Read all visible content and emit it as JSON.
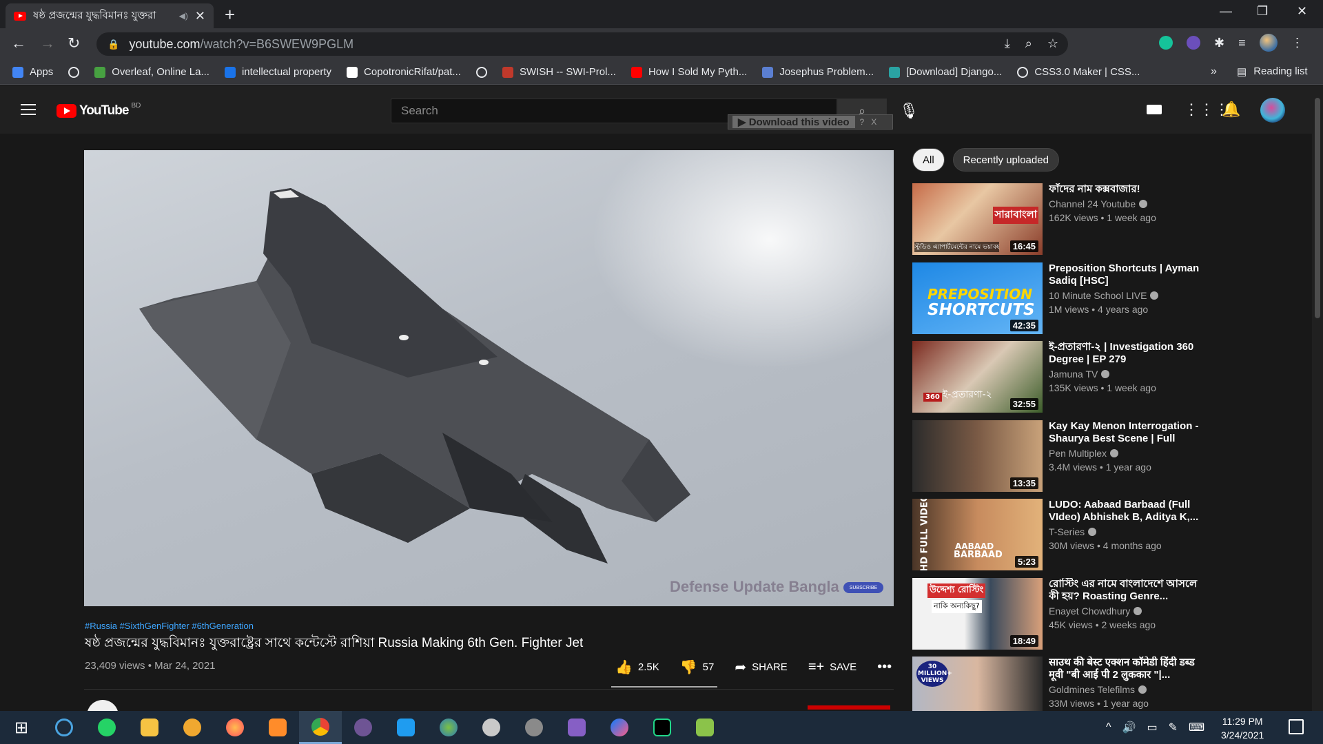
{
  "browser": {
    "tab_title": "ষষ্ঠ প্রজন্মের যুদ্ধবিমানঃ যুক্তরা",
    "url_host": "youtube.com",
    "url_path": "/watch?v=B6SWEW9PGLM",
    "bookmarks": [
      {
        "label": "Apps",
        "color": "#4285f4"
      },
      {
        "label": "",
        "color": "globe"
      },
      {
        "label": "Overleaf, Online La...",
        "color": "#47a141"
      },
      {
        "label": "intellectual property",
        "color": "#1a73e8"
      },
      {
        "label": "CopotronicRifat/pat...",
        "color": "#ffffff"
      },
      {
        "label": "",
        "color": "globe"
      },
      {
        "label": "SWISH -- SWI-Prol...",
        "color": "#c0392b"
      },
      {
        "label": "How I Sold My Pyth...",
        "color": "#ff0000"
      },
      {
        "label": "Josephus Problem...",
        "color": "#5b7fd1"
      },
      {
        "label": "[Download] Django...",
        "color": "#2aa3a3"
      },
      {
        "label": "CSS3.0 Maker | CSS...",
        "color": "globe"
      }
    ],
    "bookmarks_more": "»",
    "reading_list": "Reading list"
  },
  "youtube": {
    "country_code": "BD",
    "logo_text": "YouTube",
    "search_placeholder": "Search",
    "download_label": "▶ Download this video",
    "download_help": "?",
    "download_close": "X"
  },
  "video": {
    "watermark": "Defense Update Bangla",
    "subscribe_pill": "SUBSCRIBE",
    "hashtags": "#Russia #SixthGenFighter #6thGeneration",
    "title": "ষষ্ঠ প্রজন্মের যুদ্ধবিমানঃ যুক্তরাষ্ট্রের সাথে কন্টেস্টে রাশিয়া Russia Making 6th Gen. Fighter Jet",
    "views_date": "23,409 views • Mar 24, 2021",
    "likes": "2.5K",
    "dislikes": "57",
    "share": "SHARE",
    "save": "SAVE"
  },
  "sidebar": {
    "chips": [
      {
        "label": "All",
        "active": true
      },
      {
        "label": "Recently uploaded",
        "active": false
      }
    ],
    "recommendations": [
      {
        "title": "ফাঁদের নাম কক্সবাজার!",
        "channel": "Channel 24 Youtube",
        "meta": "162K views • 1 week ago",
        "duration": "16:45"
      },
      {
        "title": "Preposition Shortcuts | Ayman Sadiq [HSC]",
        "channel": "10 Minute School LIVE",
        "meta": "1M views • 4 years ago",
        "duration": "42:35"
      },
      {
        "title": "ই-প্রতারণা-২ | Investigation 360 Degree | EP 279",
        "channel": "Jamuna TV",
        "meta": "135K views • 1 week ago",
        "duration": "32:55"
      },
      {
        "title": "Kay Kay Menon Interrogation - Shaurya Best Scene | Full Hind...",
        "channel": "Pen Multiplex",
        "meta": "3.4M views • 1 year ago",
        "duration": "13:35"
      },
      {
        "title": "LUDO: Aabaad Barbaad (Full VIdeo) Abhishek B, Aditya K,...",
        "channel": "T-Series",
        "meta": "30M views • 4 months ago",
        "duration": "5:23"
      },
      {
        "title": "রোস্টিং এর নামে বাংলাদেশে আসলে কী হয়? Roasting Genre...",
        "channel": "Enayet Chowdhury",
        "meta": "45K views • 2 weeks ago",
        "duration": "18:49"
      },
      {
        "title": "साउथ की बेस्ट एक्शन कॉमेडी हिंदी डब्ड मूवी \"बी आई पी 2 लुककार \"|...",
        "channel": "Goldmines Telefilms",
        "meta": "33M views • 1 year ago",
        "duration": ""
      }
    ],
    "thumb_texts": {
      "t2_line1": "PREPOSITION",
      "t2_line2": "SHORTCUTS",
      "t3_badge": "360",
      "t3_text": "ই-প্রতারণা-২",
      "t5_side": "HD FULL VIDEO",
      "t5_line1": "AABAAD",
      "t5_line2": "BARBAAD",
      "t6_top": "উদ্দেশ্য রোস্টিং",
      "t6_sub": "নাকি অন্যকিছু?",
      "t7_badge": "30 MILLION+ VIEWS",
      "t1_caption": "স্টুডিও এ্যাপার্টমেন্টের নামে ভয়াবহ",
      "t1_logo": "সারাবাংলা"
    }
  },
  "taskbar": {
    "time": "11:29 PM",
    "date": "3/24/2021"
  }
}
